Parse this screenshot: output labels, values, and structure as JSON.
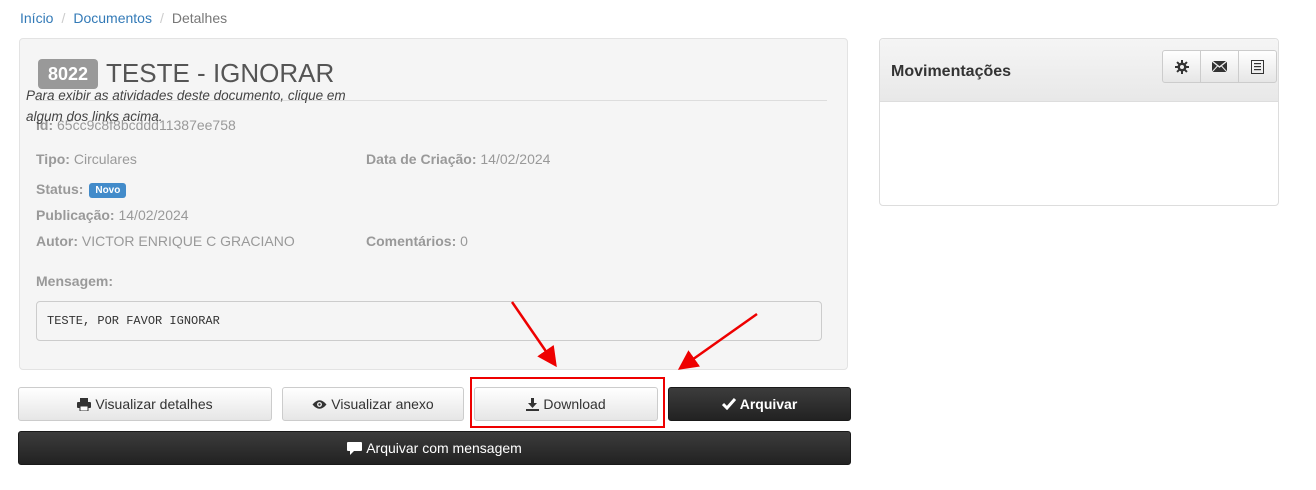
{
  "breadcrumb": {
    "items": [
      "Início",
      "Documentos"
    ],
    "separator": "/",
    "current": "Detalhes"
  },
  "document": {
    "number": "8022",
    "title": "TESTE - IGNORAR",
    "id_label": "Id:",
    "id_value": "65cc9c8f8bcddd11387ee758",
    "tipo_label": "Tipo:",
    "tipo_value": "Circulares",
    "data_criacao_label": "Data de Criação:",
    "data_criacao_value": "14/02/2024",
    "status_label": "Status:",
    "status_value": "Novo",
    "publicacao_label": "Publicação:",
    "publicacao_value": "14/02/2024",
    "autor_label": "Autor:",
    "autor_value": "VICTOR ENRIQUE C GRACIANO",
    "comentarios_label": "Comentários:",
    "comentarios_value": "0",
    "mensagem_label": "Mensagem:",
    "mensagem_value": "TESTE, POR FAVOR IGNORAR"
  },
  "actions": {
    "visualizar_detalhes": "Visualizar detalhes",
    "visualizar_anexo": "Visualizar anexo",
    "download": "Download",
    "arquivar": "Arquivar",
    "arquivar_com_mensagem": "Arquivar com mensagem"
  },
  "movimentacoes": {
    "title": "Movimentações",
    "buttons": [
      "gear-icon",
      "envelope-icon",
      "list-icon"
    ],
    "empty_text": "Para exibir as atividades deste documento, clique em algum dos links acima."
  },
  "colors": {
    "link": "#337ab7",
    "badge_status": "#428bca",
    "annotation": "#e00000",
    "dark_button": "#2b2b2b"
  }
}
